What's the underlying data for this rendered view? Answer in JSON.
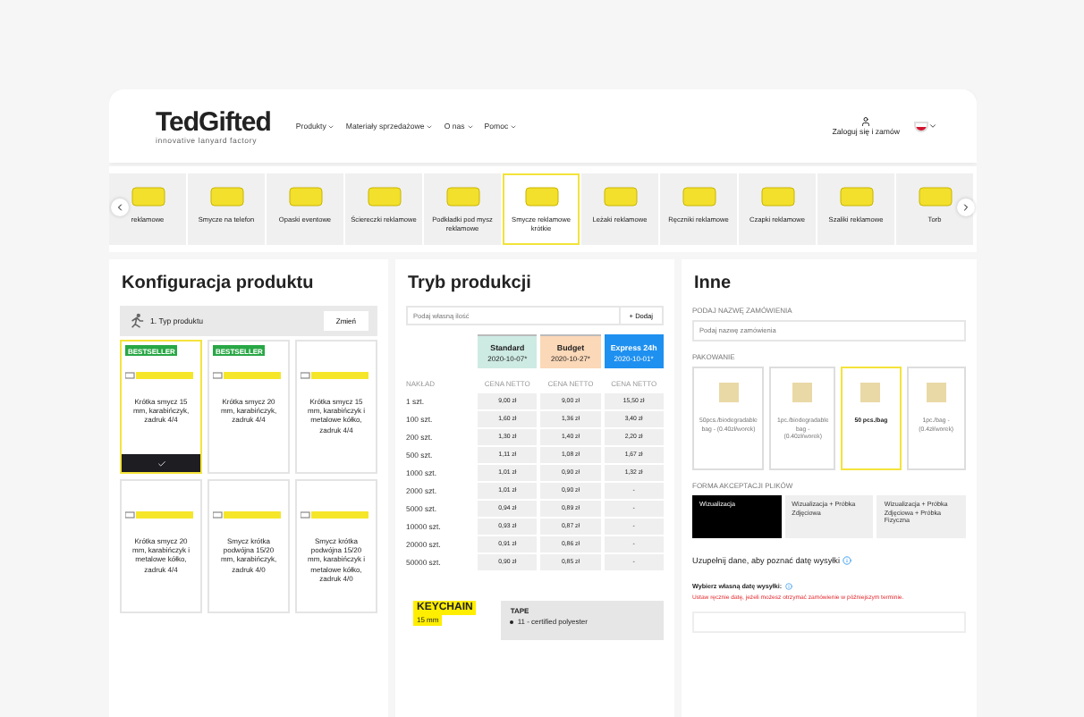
{
  "header": {
    "logo": "TedGifted",
    "tagline": "innovative lanyard factory",
    "nav": [
      "Produkty",
      "Materiały sprzedażowe",
      "O nas",
      "Pomoc"
    ],
    "login": "Zaloguj się i zamów"
  },
  "categories": [
    {
      "label": "reklamowe",
      "selected": false
    },
    {
      "label": "Smycze na telefon",
      "selected": false
    },
    {
      "label": "Opaski eventowe",
      "selected": false
    },
    {
      "label": "Ściereczki reklamowe",
      "selected": false
    },
    {
      "label": "Podkładki pod mysz reklamowe",
      "selected": false
    },
    {
      "label": "Smycze reklamowe krótkie",
      "selected": true
    },
    {
      "label": "Leżaki reklamowe",
      "selected": false
    },
    {
      "label": "Ręczniki reklamowe",
      "selected": false
    },
    {
      "label": "Czapki reklamowe",
      "selected": false
    },
    {
      "label": "Szaliki reklamowe",
      "selected": false
    },
    {
      "label": "Torb",
      "selected": false
    }
  ],
  "config": {
    "title": "Konfiguracja produktu",
    "step": "1. Typ produktu",
    "change": "Zmień",
    "products": [
      {
        "name": "Krótka smycz 15 mm, karabińczyk, zadruk 4/4",
        "badge": "BESTSELLER",
        "selected": true
      },
      {
        "name": "Krótka smycz 20 mm, karabińczyk, zadruk 4/4",
        "badge": "BESTSELLER",
        "selected": false
      },
      {
        "name": "Krótka smycz 15 mm, karabińczyk i metalowe kółko, zadruk 4/4",
        "selected": false
      },
      {
        "name": "Krótka smycz 20 mm, karabińczyk i metalowe kółko, zadruk 4/4",
        "selected": false
      },
      {
        "name": "Smycz krótka podwójna 15/20 mm, karabińczyk, zadruk 4/0",
        "selected": false
      },
      {
        "name": "Smycz krótka podwójna 15/20 mm, karabińczyk i metalowe kółko, zadruk 4/0",
        "selected": false
      }
    ]
  },
  "production": {
    "title": "Tryb produkcji",
    "placeholder": "Podaj własną ilość",
    "add": "+ Dodaj",
    "qty_header": "NAKŁAD",
    "modes": [
      {
        "name": "Standard",
        "date": "2020-10-07*",
        "price_header": "CENA NETTO",
        "color": "#cdeae3",
        "selected": false
      },
      {
        "name": "Budget",
        "date": "2020-10-27*",
        "price_header": "CENA NETTO",
        "color": "#fbd8b8",
        "selected": false
      },
      {
        "name": "Express 24h",
        "date": "2020-10-01*",
        "price_header": "CENA NETTO",
        "color": "#1e90f0",
        "selected": true
      }
    ],
    "rows": [
      {
        "qty": "1 szt.",
        "prices": [
          "9,00 zł",
          "9,00 zł",
          "15,50 zł"
        ]
      },
      {
        "qty": "100 szt.",
        "prices": [
          "1,60 zł",
          "1,36 zł",
          "3,40 zł"
        ]
      },
      {
        "qty": "200 szt.",
        "prices": [
          "1,30 zł",
          "1,40 zł",
          "2,20 zł"
        ]
      },
      {
        "qty": "500 szt.",
        "prices": [
          "1,11 zł",
          "1,08 zł",
          "1,67 zł"
        ]
      },
      {
        "qty": "1000 szt.",
        "prices": [
          "1,01 zł",
          "0,90 zł",
          "1,32 zł"
        ]
      },
      {
        "qty": "2000 szt.",
        "prices": [
          "1,01 zł",
          "0,90 zł",
          "-"
        ]
      },
      {
        "qty": "5000 szt.",
        "prices": [
          "0,94 zł",
          "0,89 zł",
          "-"
        ]
      },
      {
        "qty": "10000 szt.",
        "prices": [
          "0,93 zł",
          "0,87 zł",
          "-"
        ]
      },
      {
        "qty": "20000 szt.",
        "prices": [
          "0,91 zł",
          "0,86 zł",
          "-"
        ]
      },
      {
        "qty": "50000 szt.",
        "prices": [
          "0,90 zł",
          "0,85 zł",
          "-"
        ]
      }
    ],
    "keychain": {
      "title": "KEYCHAIN",
      "size": "15 mm"
    },
    "tape": {
      "title": "TAPE",
      "items": [
        "11 - certified polyester"
      ]
    }
  },
  "other": {
    "title": "Inne",
    "name_label": "PODAJ NAZWĘ ZAMÓWIENIA",
    "name_placeholder": "Podaj nazwę zamówienia",
    "packing_label": "PAKOWANIE",
    "packing": [
      {
        "label": "50pcs./biodegradable bag - (0.40zł/worek)",
        "selected": false
      },
      {
        "label": "1pc./biodegradable bag - (0.40zł/worek)",
        "selected": false
      },
      {
        "label": "50 pcs./bag",
        "selected": true
      },
      {
        "label": "1pc./bag - (0.4zł/worek)",
        "selected": false
      }
    ],
    "accept_label": "FORMA AKCEPTACJI PLIKÓW",
    "accept": [
      {
        "label": "Wizualizacja",
        "selected": true
      },
      {
        "label": "Wizualizacja + Próbka Zdjęciowa",
        "selected": false
      },
      {
        "label": "Wizualizacja + Próbka Zdjęciowa + Próbka Fizyczna",
        "selected": false
      }
    ],
    "ship_note": "Uzupełnij dane, aby poznać datę wysyłki",
    "own_date": "Wybierz własną datę wysyłki:",
    "own_date_hint": "Ustaw ręcznie datę, jeżeli możesz otrzymać zamówienie w późniejszym terminie."
  }
}
